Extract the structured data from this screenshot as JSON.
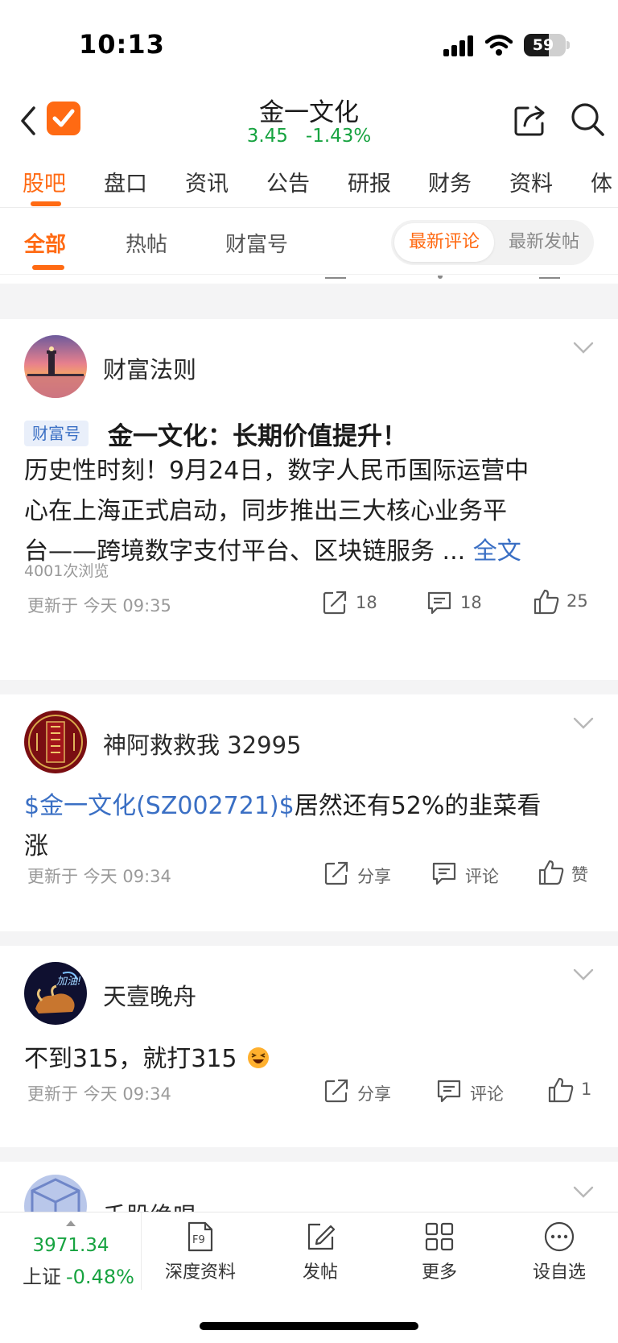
{
  "status_bar": {
    "time": "10:13",
    "battery": "59",
    "battery_level": 0.59
  },
  "header": {
    "stock_name": "金一文化",
    "price": "3.45",
    "change_pct": "-1.43%"
  },
  "main_tabs": [
    "股吧",
    "盘口",
    "资讯",
    "公告",
    "研报",
    "财务",
    "资料",
    "体"
  ],
  "sub_tabs": [
    "全部",
    "热帖",
    "财富号"
  ],
  "sort_options": {
    "active": "最新评论",
    "inactive": "最新发帖"
  },
  "posts": [
    {
      "author": "财富法则",
      "tag": "财富号",
      "title": "金一文化：长期价值提升！",
      "body_lines": [
        "历史性时刻！9月24日，数字人民币国际运营中",
        "心在上海正式启动，同步推出三大核心业务平",
        "台——跨境数字支付平台、区块链服务 ..."
      ],
      "more": "全文",
      "views": "4001次浏览",
      "time": "更新于 今天 09:35",
      "share": "18",
      "comment": "18",
      "like": "25"
    },
    {
      "author": "神阿救救我 32995",
      "stock_link": "$金一文化(SZ002721)$",
      "body_after_link": "居然还有52%的韭菜看",
      "body_line2": "涨",
      "time": "更新于 今天 09:34",
      "share": "分享",
      "comment": "评论",
      "like": "赞"
    },
    {
      "author": "天壹晚舟",
      "body": "不到315，就打315",
      "avatar_text": "加油!",
      "time": "更新于 今天 09:34",
      "share": "分享",
      "comment": "评论",
      "like": "1"
    },
    {
      "author": "千股绝唱"
    }
  ],
  "bottom_bar": {
    "index_value": "3971.34",
    "index_name": "上证",
    "index_change": "-0.48%",
    "nav": [
      "深度资料",
      "发帖",
      "更多",
      "设自选"
    ],
    "f9_label": "F9"
  },
  "colors": {
    "accent": "#ff6a13",
    "down": "#17a340",
    "link": "#3a6fc4"
  }
}
